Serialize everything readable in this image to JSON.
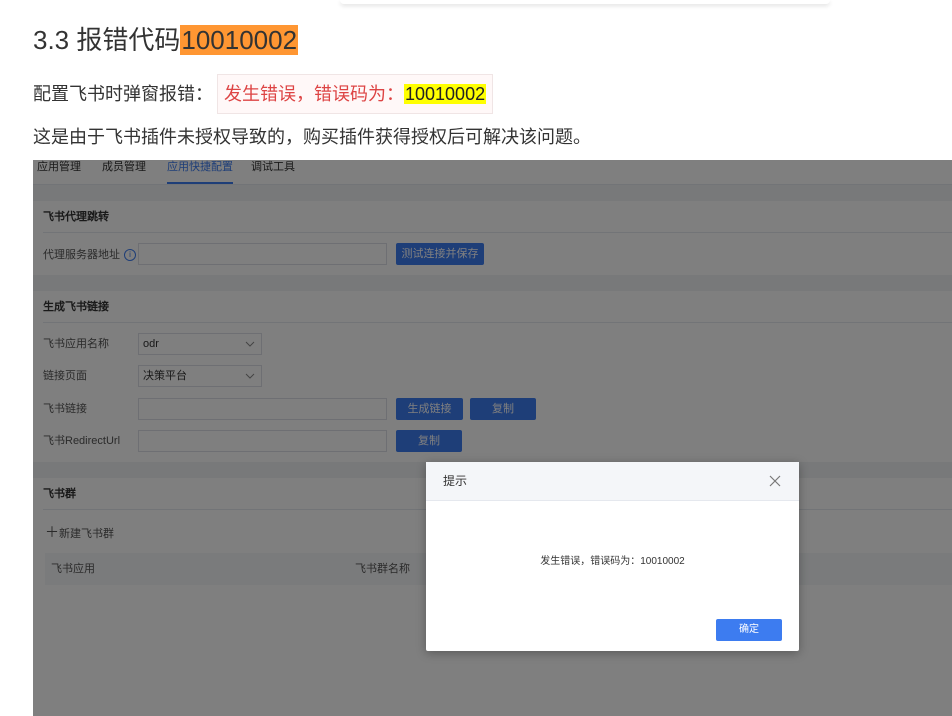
{
  "heading": {
    "prefix": "3.3 报错代码",
    "code": "10010002"
  },
  "para1": {
    "lead": "配置飞书时弹窗报错：",
    "error_text": "发生错误，错误码为：",
    "error_code": "10010002"
  },
  "para2": "这是由于飞书插件未授权导致的，购买插件获得授权后可解决该问题。",
  "screenshot": {
    "tabs": [
      "应用管理",
      "成员管理",
      "应用快捷配置",
      "调试工具"
    ],
    "active_tab": 2,
    "proxy_section": {
      "title": "飞书代理跳转",
      "server_label": "代理服务器地址",
      "info_glyph": "i",
      "test_button": "测试连接并保存"
    },
    "link_section": {
      "title": "生成飞书链接",
      "app_name_label": "飞书应用名称",
      "app_name_value": "odr",
      "page_label": "链接页面",
      "page_value": "决策平台",
      "link_label": "飞书链接",
      "generate_button": "生成链接",
      "copy_button": "复制",
      "redirect_label": "飞书RedirectUrl",
      "copy_button_2": "复制"
    },
    "group_section": {
      "title": "飞书群",
      "new_group": "新建飞书群",
      "columns": [
        "飞书应用",
        "飞书群名称"
      ]
    },
    "dialog": {
      "title": "提示",
      "message": "发生错误，错误码为：10010002",
      "ok_button": "确定"
    },
    "colors": {
      "primary": "#3d7cf0",
      "overlay": "rgba(0,0,0,0.5)"
    }
  },
  "colors": {
    "orange_highlight": "#ff9632",
    "yellow_highlight": "#ffff00",
    "error_red": "#dd4444"
  }
}
